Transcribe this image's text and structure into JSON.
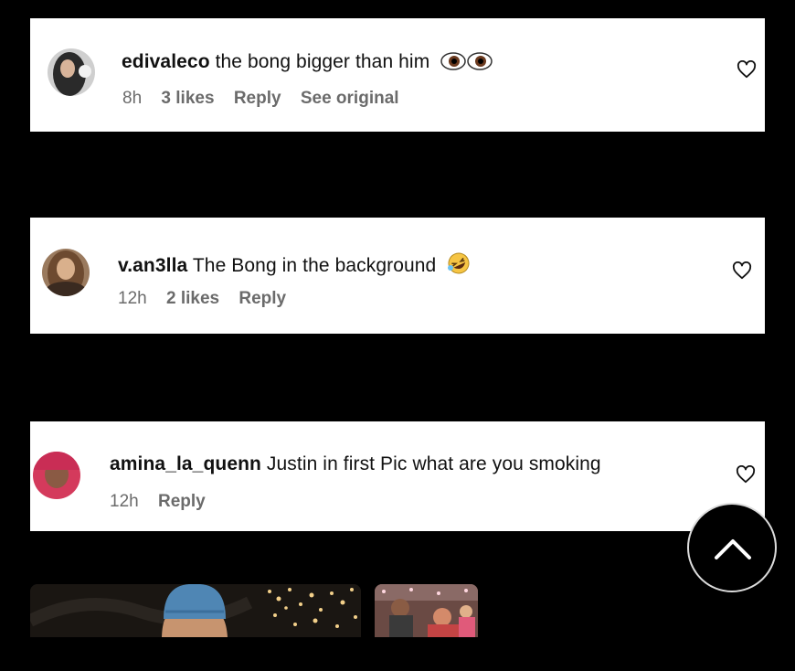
{
  "comments": [
    {
      "username": "edivaleco",
      "text": "the bong bigger than him",
      "emoji": "eyes-emoji",
      "time": "8h",
      "likes": "3 likes",
      "reply": "Reply",
      "see_original": "See original"
    },
    {
      "username": "v.an3lla",
      "text": "The Bong in the background",
      "emoji": "rofl-emoji",
      "time": "12h",
      "likes": "2 likes",
      "reply": "Reply"
    },
    {
      "username": "amina_la_quenn",
      "text": "Justin in first Pic what are you smoking",
      "time": "12h",
      "reply": "Reply"
    }
  ],
  "icons": {
    "like": "heart-outline-icon",
    "scroll_top": "chevron-up-icon"
  },
  "colors": {
    "background": "#000000",
    "card": "#ffffff",
    "meta_text": "#6b6b6b"
  }
}
